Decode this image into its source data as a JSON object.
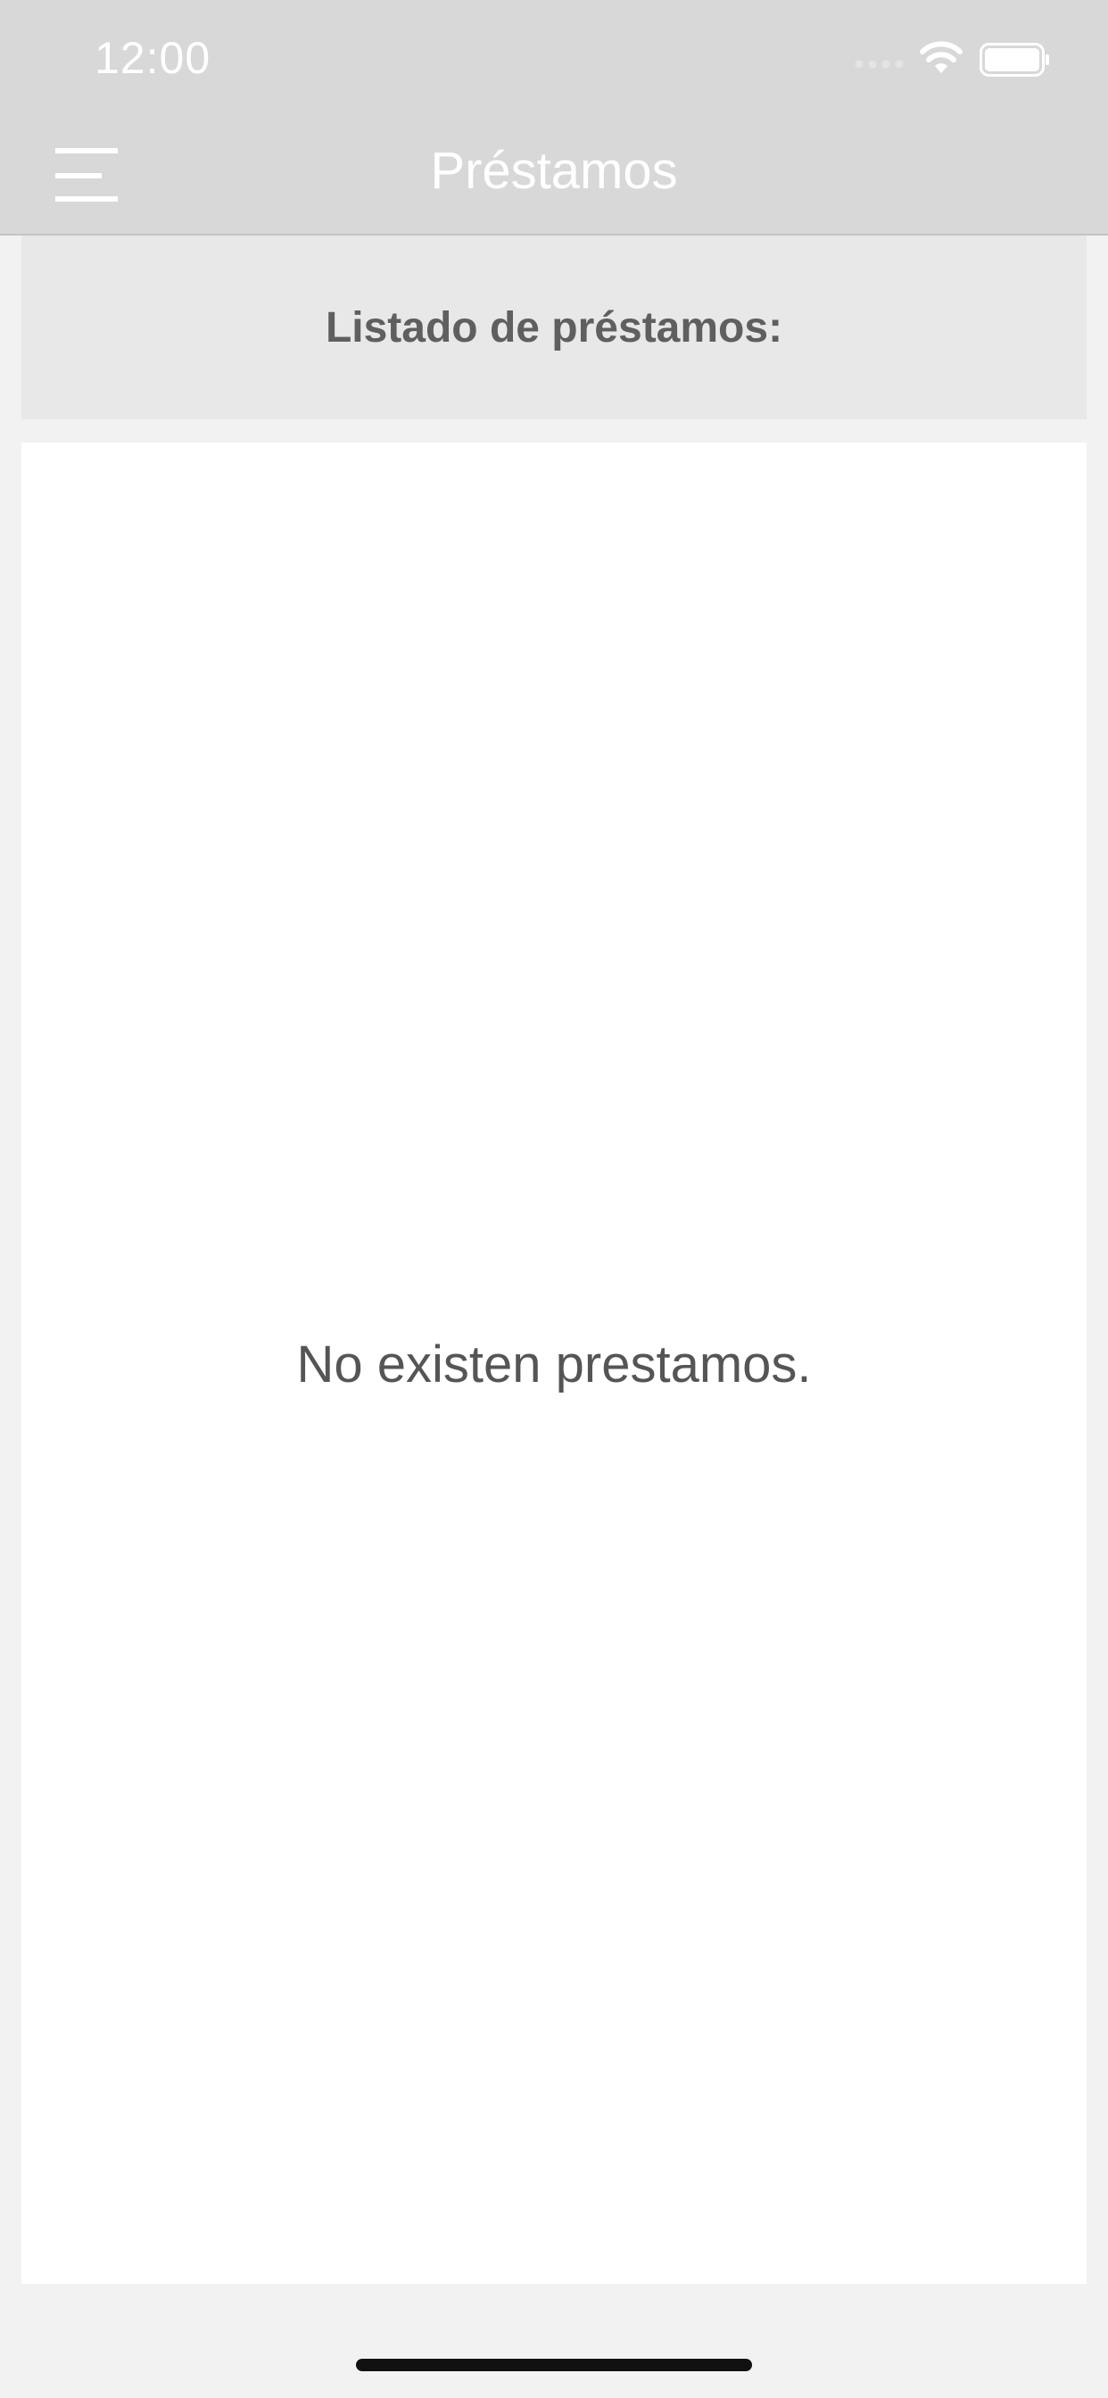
{
  "status_bar": {
    "time": "12:00",
    "icons": [
      "cellular-signal-icon",
      "wifi-icon",
      "battery-icon"
    ]
  },
  "nav_bar": {
    "title": "Préstamos",
    "menu_icon": "hamburger-menu-icon"
  },
  "list_header": {
    "title": "Listado de préstamos:"
  },
  "content": {
    "empty_message": "No existen prestamos."
  },
  "colors": {
    "nav_background": "#d8d8d8",
    "nav_text": "#ffffff",
    "header_background": "#e8e8e8",
    "header_text": "#5f5f5f",
    "page_background": "#f2f2f2",
    "card_background": "#ffffff",
    "message_text": "#555555"
  }
}
